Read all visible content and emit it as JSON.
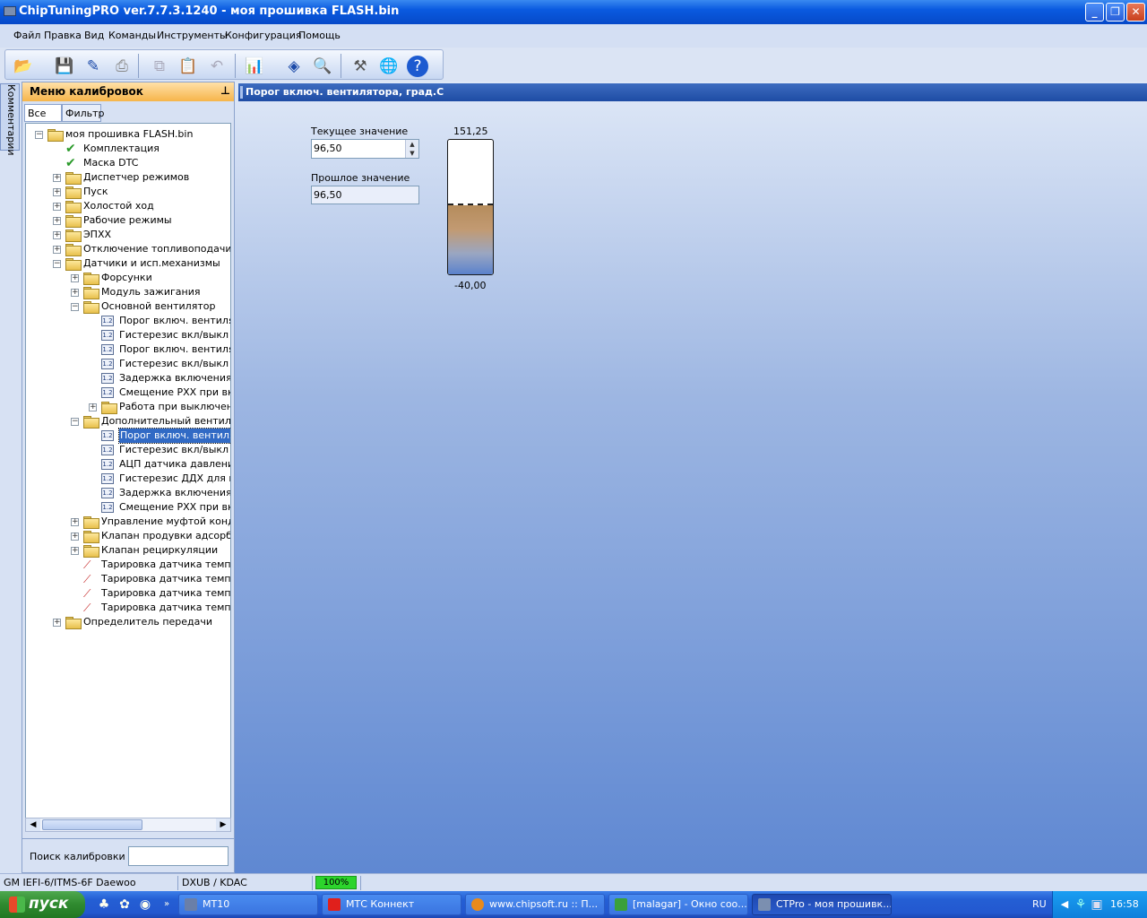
{
  "window": {
    "title": "ChipTuningPRO ver.7.7.3.1240 - моя прошивка FLASH.bin",
    "minimize": "_",
    "restore": "❐",
    "close": "✕"
  },
  "menu": [
    "Файл",
    "Правка",
    "Вид",
    "Команды",
    "Инструменты",
    "Конфигурация",
    "Помощь"
  ],
  "side_tab": "Комментарии",
  "calibrations_panel": {
    "title": "Меню калибровок",
    "pin": "⊥",
    "tabs": [
      "Все",
      "Фильтр"
    ],
    "search_label": "Поиск калибровки",
    "search_value": "",
    "tree": [
      {
        "label": "моя прошивка FLASH.bin",
        "level": 0,
        "icon": "folder",
        "exp": "−"
      },
      {
        "label": "Комплектация",
        "level": 1,
        "icon": "check"
      },
      {
        "label": "Маска DTC",
        "level": 1,
        "icon": "check"
      },
      {
        "label": "Диспетчер режимов",
        "level": 1,
        "icon": "folder",
        "exp": "+"
      },
      {
        "label": "Пуск",
        "level": 1,
        "icon": "folder",
        "exp": "+"
      },
      {
        "label": "Холостой ход",
        "level": 1,
        "icon": "folder",
        "exp": "+"
      },
      {
        "label": "Рабочие режимы",
        "level": 1,
        "icon": "folder",
        "exp": "+"
      },
      {
        "label": "ЭПХХ",
        "level": 1,
        "icon": "folder",
        "exp": "+"
      },
      {
        "label": "Отключение топливоподачи",
        "level": 1,
        "icon": "folder",
        "exp": "+"
      },
      {
        "label": "Датчики и исп.механизмы",
        "level": 1,
        "icon": "folder",
        "exp": "−"
      },
      {
        "label": "Форсунки",
        "level": 2,
        "icon": "folder",
        "exp": "+"
      },
      {
        "label": "Модуль зажигания",
        "level": 2,
        "icon": "folder",
        "exp": "+"
      },
      {
        "label": "Основной вентилятор",
        "level": 2,
        "icon": "folder",
        "exp": "−"
      },
      {
        "label": "Порог включ. вентилятора",
        "level": 3,
        "icon": "value"
      },
      {
        "label": "Гистерезис вкл/выкл (о",
        "level": 3,
        "icon": "value"
      },
      {
        "label": "Порог включ. вентилятора",
        "level": 3,
        "icon": "value"
      },
      {
        "label": "Гистерезис вкл/выкл (р",
        "level": 3,
        "icon": "value"
      },
      {
        "label": "Задержка включения",
        "level": 3,
        "icon": "value"
      },
      {
        "label": "Смещение РХХ при включ",
        "level": 3,
        "icon": "value"
      },
      {
        "label": "Работа при выключенно",
        "level": 3,
        "icon": "folder",
        "exp": "+"
      },
      {
        "label": "Дополнительный вентилятор",
        "level": 2,
        "icon": "folder",
        "exp": "−"
      },
      {
        "label": "Порог включ. вентилятора",
        "level": 3,
        "icon": "value",
        "selected": true
      },
      {
        "label": "Гистерезис вкл/выкл",
        "level": 3,
        "icon": "value"
      },
      {
        "label": "АЦП датчика давления",
        "level": 3,
        "icon": "value"
      },
      {
        "label": "Гистерезис ДДХ для вкл",
        "level": 3,
        "icon": "value"
      },
      {
        "label": "Задержка включения",
        "level": 3,
        "icon": "value"
      },
      {
        "label": "Смещение РХХ при включ",
        "level": 3,
        "icon": "value"
      },
      {
        "label": "Управление муфтой кондиц",
        "level": 2,
        "icon": "folder",
        "exp": "+"
      },
      {
        "label": "Клапан продувки адсорбера",
        "level": 2,
        "icon": "folder",
        "exp": "+"
      },
      {
        "label": "Клапан рециркуляции",
        "level": 2,
        "icon": "folder",
        "exp": "+"
      },
      {
        "label": "Тарировка датчика темпера",
        "level": 2,
        "icon": "graph"
      },
      {
        "label": "Тарировка датчика темпера",
        "level": 2,
        "icon": "graph"
      },
      {
        "label": "Тарировка датчика темпера",
        "level": 2,
        "icon": "graph"
      },
      {
        "label": "Тарировка датчика темпера",
        "level": 2,
        "icon": "graph"
      },
      {
        "label": "Определитель передачи",
        "level": 1,
        "icon": "folder",
        "exp": "+"
      }
    ]
  },
  "editor": {
    "title": "Порог включ. вентилятора, град.С",
    "current_label": "Текущее значение",
    "current_value": "96,50",
    "previous_label": "Прошлое значение",
    "previous_value": "96,50",
    "gauge": {
      "max_label": "151,25",
      "min_label": "-40,00",
      "max": 151.25,
      "min": -40.0,
      "value": 96.5
    }
  },
  "status": {
    "ecu": "GM IEFI-6/ITMS-6F Daewoo",
    "mode": "DXUB / KDAC",
    "progress": "100%"
  },
  "taskbar": {
    "start": "пуск",
    "tasks": [
      "MT10",
      "МТС Коннект",
      "www.chipsoft.ru :: П...",
      "[malagar] - Окно соо...",
      "CTPro - моя прошивк..."
    ],
    "lang": "RU",
    "clock": "16:58"
  }
}
